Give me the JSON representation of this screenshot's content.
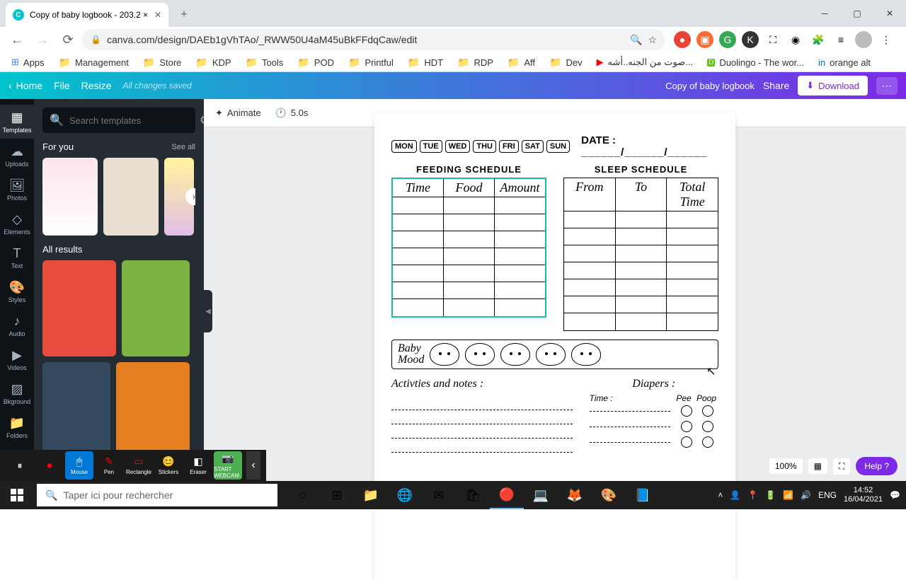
{
  "browser": {
    "tab_title": "Copy of baby logbook - 203.2 ×",
    "url": "canva.com/design/DAEb1gVhTAo/_RWW50U4aM45uBkFFdqCaw/edit"
  },
  "bookmarks": [
    "Apps",
    "Management",
    "Store",
    "KDP",
    "Tools",
    "POD",
    "Printful",
    "HDT",
    "RDP",
    "Aff",
    "Dev",
    "صوت من الجنه..أشه...",
    "Duolingo - The wor...",
    "orange alt"
  ],
  "canva": {
    "home": "Home",
    "file": "File",
    "resize": "Resize",
    "saved": "All changes saved",
    "doc_title": "Copy of baby logbook",
    "share": "Share",
    "download": "Download",
    "animate": "Animate",
    "duration": "5.0s"
  },
  "rail": [
    "Templates",
    "Uploads",
    "Photos",
    "Elements",
    "Text",
    "Styles",
    "Audio",
    "Videos",
    "Bkground",
    "Folders"
  ],
  "panel": {
    "search_placeholder": "Search templates",
    "for_you": "For you",
    "see_all": "See all",
    "all_results": "All results"
  },
  "logbook": {
    "days": [
      "MON",
      "TUE",
      "WED",
      "THU",
      "FRI",
      "SAT",
      "SUN"
    ],
    "date_label": "DATE :",
    "date_blank": "______/______/______",
    "feeding_title": "FEEDING SCHEDULE",
    "feeding_headers": [
      "Time",
      "Food",
      "Amount"
    ],
    "sleep_title": "SLEEP SCHEDULE",
    "sleep_headers": [
      "From",
      "To",
      "Total Time"
    ],
    "mood_label": "Baby\nMood",
    "activities_title": "Activties and notes :",
    "diapers_title": "Diapers :",
    "diapers_time": "Time :",
    "diapers_pee": "Pee",
    "diapers_poop": "Poop"
  },
  "recorder": {
    "mouse": "Mouse",
    "pen": "Pen",
    "rectangle": "Rectangle",
    "stickers": "Stickers",
    "eraser": "Eraser",
    "start": "START WEBCAM"
  },
  "zoom": {
    "value": "100%",
    "help": "Help ?"
  },
  "taskbar": {
    "search_placeholder": "Taper ici pour rechercher",
    "lang": "ENG",
    "time": "14:52",
    "date": "16/04/2021"
  }
}
